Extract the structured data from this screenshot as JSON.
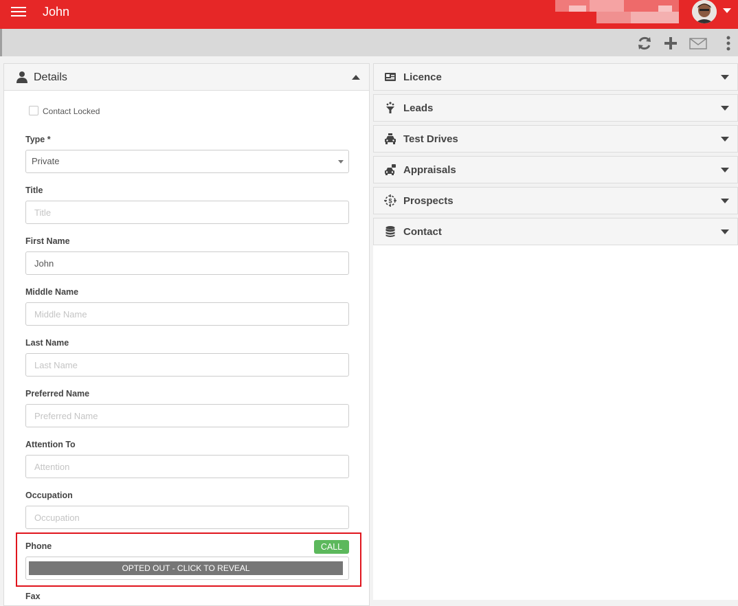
{
  "header": {
    "title": "John",
    "brand_color": "#e62727"
  },
  "toolbar": {
    "icons": [
      "refresh-icon",
      "plus-icon",
      "envelope-icon",
      "kebab-menu-icon"
    ]
  },
  "details": {
    "title": "Details",
    "contact_locked_label": "Contact Locked",
    "type_label": "Type *",
    "type_value": "Private",
    "title_label": "Title",
    "title_placeholder": "Title",
    "first_name_label": "First Name",
    "first_name_value": "John",
    "middle_name_label": "Middle Name",
    "middle_name_placeholder": "Middle Name",
    "last_name_label": "Last Name",
    "last_name_placeholder": "Last Name",
    "preferred_name_label": "Preferred Name",
    "preferred_name_placeholder": "Preferred Name",
    "attention_label": "Attention To",
    "attention_placeholder": "Attention",
    "occupation_label": "Occupation",
    "occupation_placeholder": "Occupation",
    "phone_label": "Phone",
    "call_label": "CALL",
    "opted_out_label": "OPTED OUT - CLICK TO REVEAL",
    "fax_label": "Fax"
  },
  "accordions": [
    {
      "label": "Licence",
      "icon": "id-card-icon"
    },
    {
      "label": "Leads",
      "icon": "funnel-icon"
    },
    {
      "label": "Test Drives",
      "icon": "taxi-icon"
    },
    {
      "label": "Appraisals",
      "icon": "car-appraisal-icon"
    },
    {
      "label": "Prospects",
      "icon": "dollar-target-icon"
    },
    {
      "label": "Contact",
      "icon": "database-icon"
    }
  ]
}
